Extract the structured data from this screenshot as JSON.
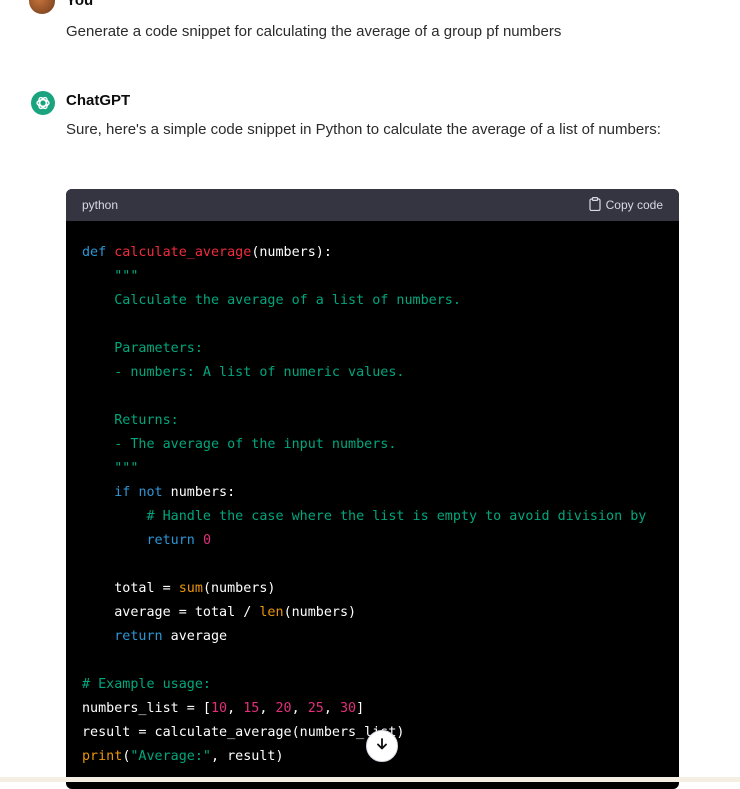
{
  "user": {
    "name": "You",
    "message": "Generate a code snippet for calculating the average of a group pf numbers"
  },
  "assistant": {
    "name": "ChatGPT",
    "intro": "Sure, here's a simple code snippet in Python to calculate the average of a list of numbers:"
  },
  "code_block": {
    "language": "python",
    "copy_label": "Copy code",
    "lines": [
      "def calculate_average(numbers):",
      "    \"\"\"",
      "    Calculate the average of a list of numbers.",
      "",
      "    Parameters:",
      "    - numbers: A list of numeric values.",
      "",
      "    Returns:",
      "    - The average of the input numbers.",
      "    \"\"\"",
      "    if not numbers:",
      "        # Handle the case where the list is empty to avoid division by",
      "        return 0",
      "",
      "    total = sum(numbers)",
      "    average = total / len(numbers)",
      "    return average",
      "",
      "# Example usage:",
      "numbers_list = [10, 15, 20, 25, 30]",
      "result = calculate_average(numbers_list)",
      "print(\"Average:\", result)"
    ]
  },
  "icons": {
    "copy": "clipboard-icon",
    "scroll": "arrow-down-icon",
    "assistant_logo": "openai-logo-icon"
  },
  "colors": {
    "keyword": "#2e95d3",
    "function": "#f22c3d",
    "string": "#00a67d",
    "comment": "#00a67d",
    "number": "#df3079",
    "builtin": "#e9950c",
    "code_bg": "#000000",
    "header_bg": "#343541",
    "assistant_avatar": "#19a37f"
  }
}
